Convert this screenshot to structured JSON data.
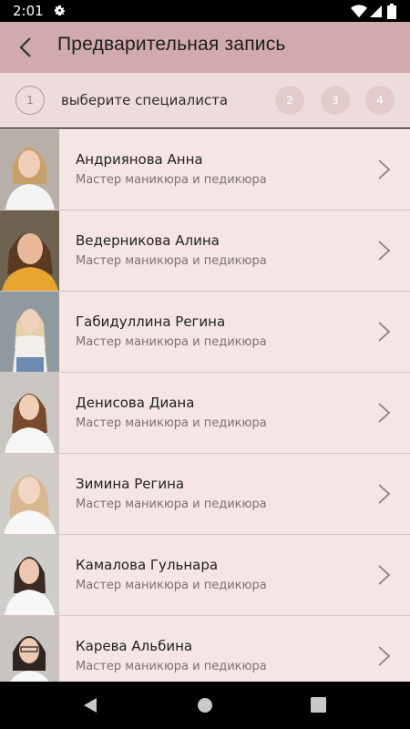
{
  "status_bar": {
    "time": "2:01",
    "icons": [
      "gear-icon",
      "wifi-icon",
      "signal-icon",
      "battery-icon"
    ]
  },
  "app_bar": {
    "title": "Предварительная запись",
    "back_icon": "back-arrow-icon",
    "background": "#d1aaab"
  },
  "steps": {
    "current": "1",
    "current_label": "выберите специалиста",
    "others": [
      "2",
      "3",
      "4"
    ]
  },
  "specialists": [
    {
      "name": "Андриянова Анна",
      "role": "Мастер маникюра и педикюра"
    },
    {
      "name": "Ведерникова Алина",
      "role": "Мастер маникюра и педикюра"
    },
    {
      "name": "Габидуллина Регина",
      "role": "Мастер маникюра и педикюра"
    },
    {
      "name": "Денисова Диана",
      "role": "Мастер маникюра и педикюра"
    },
    {
      "name": "Зимина Регина",
      "role": "Мастер маникюра и педикюра"
    },
    {
      "name": "Камалова Гульнара",
      "role": "Мастер маникюра и педикюра"
    },
    {
      "name": "Карева Альбина",
      "role": "Мастер маникюра и педикюра"
    }
  ],
  "colors": {
    "list_background": "#f5e5e5",
    "steps_background": "#eedcdc",
    "step_inactive": "#e3cbcb"
  },
  "nav_bar": {
    "icons": [
      "nav-back-icon",
      "nav-home-icon",
      "nav-recents-icon"
    ]
  }
}
